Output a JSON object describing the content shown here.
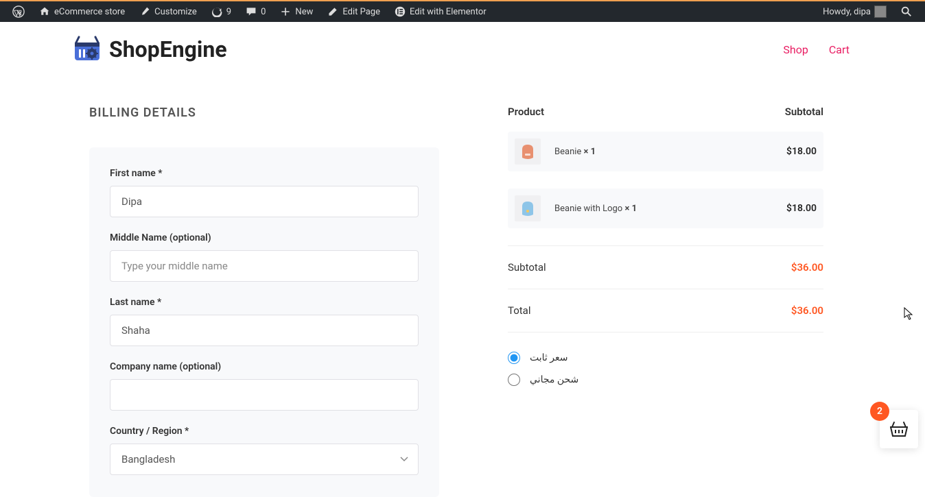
{
  "adminbar": {
    "site": "eCommerce store",
    "customize": "Customize",
    "updates": "9",
    "comments": "0",
    "new": "New",
    "edit_page": "Edit Page",
    "elementor": "Edit with Elementor",
    "greeting": "Howdy, dipa"
  },
  "header": {
    "brand": "ShopEngine",
    "nav": {
      "shop": "Shop",
      "cart": "Cart"
    }
  },
  "billing": {
    "title": "BILLING DETAILS",
    "first_name_label": "First name *",
    "first_name": "Dipa",
    "middle_label": "Middle Name (optional)",
    "middle_placeholder": "Type your middle name",
    "last_name_label": "Last name *",
    "last_name": "Shaha",
    "company_label": "Company name (optional)",
    "country_label": "Country / Region *",
    "country": "Bangladesh"
  },
  "order": {
    "head_product": "Product",
    "head_subtotal": "Subtotal",
    "items": [
      {
        "name": "Beanie ",
        "qty": "× 1",
        "price": "$18.00",
        "color": "#e89070"
      },
      {
        "name": "Beanie with Logo ",
        "qty": "× 1",
        "price": "$18.00",
        "color": "#8ec5e8"
      }
    ],
    "subtotal_label": "Subtotal",
    "subtotal": "$36.00",
    "total_label": "Total",
    "total": "$36.00",
    "shipping": {
      "opt1": "سعر ثابت",
      "opt2": "شحن مجاني"
    }
  },
  "cart_float": {
    "count": "2"
  }
}
